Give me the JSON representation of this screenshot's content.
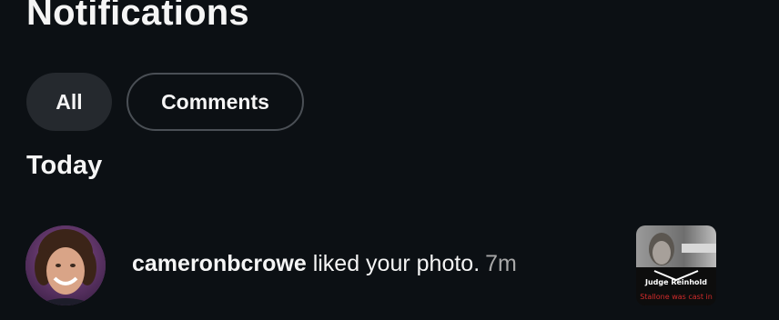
{
  "header": {
    "title": "Notifications"
  },
  "filters": [
    {
      "label": "All",
      "selected": true
    },
    {
      "label": "Comments",
      "selected": false
    }
  ],
  "sections": [
    {
      "heading": "Today",
      "notifications": [
        {
          "username": "cameronbcrowe",
          "action": " liked your photo.",
          "time": "7m",
          "thumbnail": {
            "overlay_title": "Judge Reinhold",
            "overlay_caption": "Stallone was cast in"
          }
        }
      ]
    }
  ],
  "colors": {
    "background": "#0c1014",
    "chip_selected": "#25292e",
    "chip_border": "#4a4f55",
    "muted_text": "#a8a8a8",
    "caption_red": "#d22b2b"
  }
}
